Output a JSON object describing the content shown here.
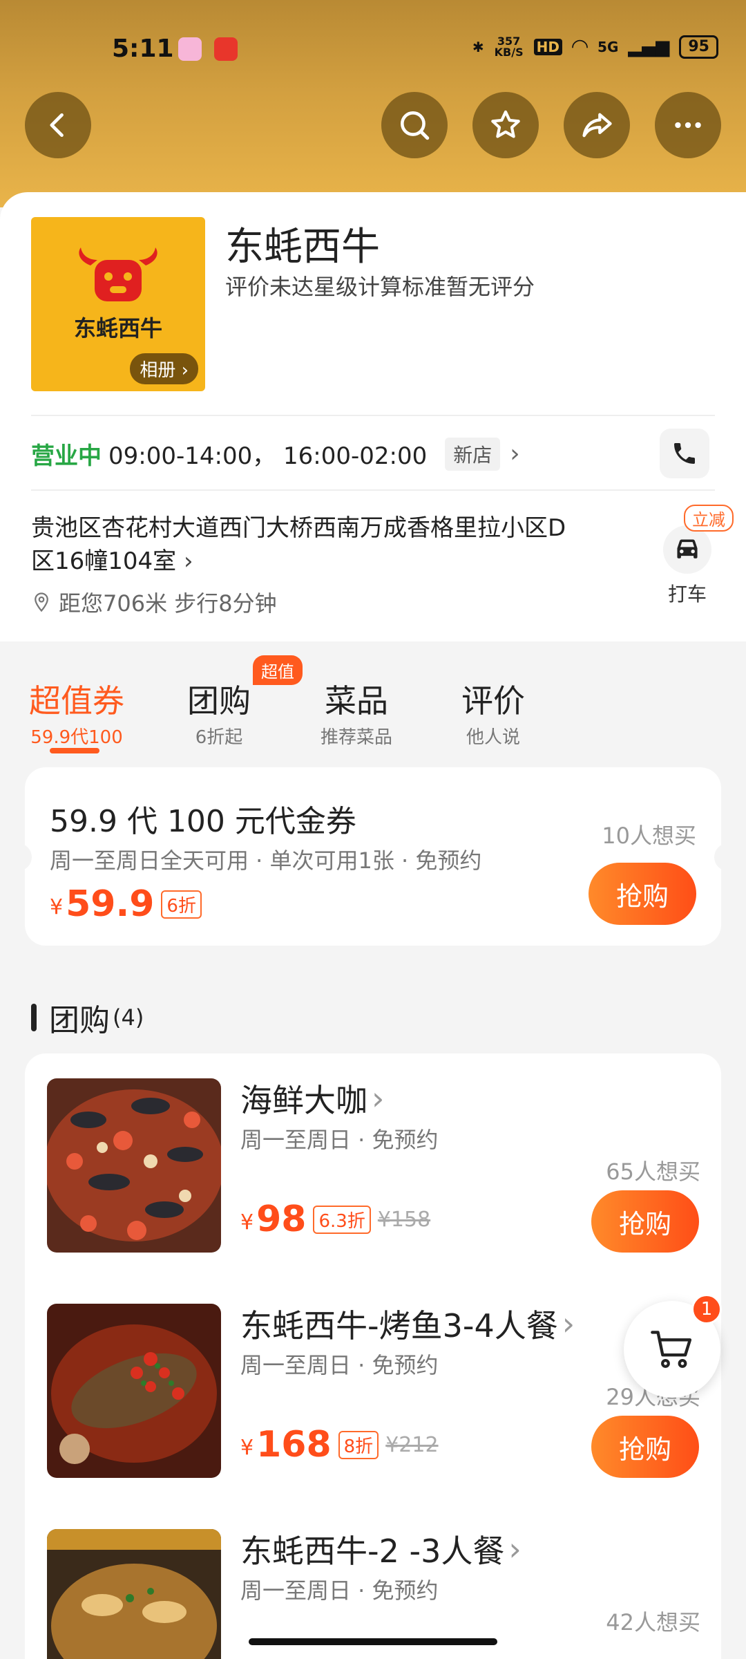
{
  "status_bar": {
    "time": "5:11",
    "net_speed": "357 KB/S",
    "hd": "HD",
    "network": "5G",
    "battery": "95"
  },
  "shop": {
    "name": "东蚝西牛",
    "rating_note": "评价未达星级计算标准暂无评分",
    "album_label": "相册",
    "logo_text": "东蚝西牛",
    "open_status": "营业中",
    "hours": "09:00-14:00， 16:00-02:00",
    "new_tag": "新店",
    "address": "贵池区杏花村大道西门大桥西南万成香格里拉小区D区16幢104室",
    "distance": "距您706米 步行8分钟",
    "taxi_tag": "立减",
    "taxi_label": "打车"
  },
  "tabs": [
    {
      "title": "超值券",
      "sub": "59.9代100",
      "active": true
    },
    {
      "title": "团购",
      "sub": "6折起",
      "badge": "超值"
    },
    {
      "title": "菜品",
      "sub": "推荐菜品"
    },
    {
      "title": "评价",
      "sub": "他人说"
    }
  ],
  "voucher": {
    "title": "59.9 代 100 元代金券",
    "desc": "周一至周日全天可用 · 单次可用1张 · 免预约",
    "currency": "¥",
    "price": "59.9",
    "discount": "6折",
    "want": "10人想买",
    "buy_label": "抢购"
  },
  "group_section": {
    "title": "团购",
    "count": "(4)"
  },
  "deals": [
    {
      "name": "海鲜大咖",
      "desc": "周一至周日 · 免预约",
      "currency": "¥",
      "price": "98",
      "discount": "6.3折",
      "original": "¥158",
      "want": "65人想买",
      "buy_label": "抢购"
    },
    {
      "name": "东蚝西牛-烤鱼3-4人餐",
      "desc": "周一至周日 · 免预约",
      "currency": "¥",
      "price": "168",
      "discount": "8折",
      "original": "¥212",
      "want": "29人想买",
      "buy_label": "抢购"
    },
    {
      "name": "东蚝西牛-2 -3人餐",
      "desc": "周一至周日 · 免预约",
      "want": "42人想买"
    }
  ],
  "cart": {
    "count": "1"
  },
  "colors": {
    "accent": "#ff5a1e",
    "header_gold": "#d3a040",
    "open_green": "#28a745"
  }
}
